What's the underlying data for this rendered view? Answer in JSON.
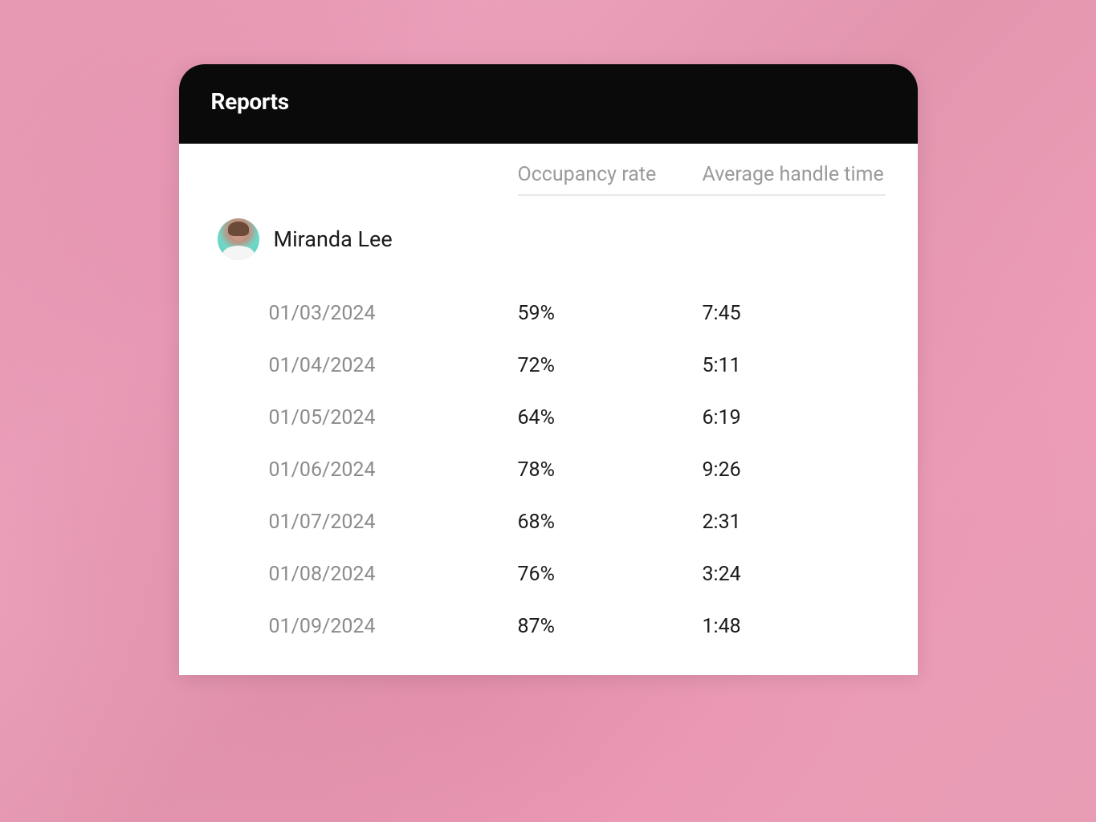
{
  "header": {
    "title": "Reports"
  },
  "columns": {
    "occupancy": "Occupancy rate",
    "handle_time": "Average handle time"
  },
  "agent": {
    "name": "Miranda Lee"
  },
  "rows": [
    {
      "date": "01/03/2024",
      "rate": "59%",
      "time": "7:45"
    },
    {
      "date": "01/04/2024",
      "rate": "72%",
      "time": "5:11"
    },
    {
      "date": "01/05/2024",
      "rate": "64%",
      "time": "6:19"
    },
    {
      "date": "01/06/2024",
      "rate": "78%",
      "time": "9:26"
    },
    {
      "date": "01/07/2024",
      "rate": "68%",
      "time": "2:31"
    },
    {
      "date": "01/08/2024",
      "rate": "76%",
      "time": "3:24"
    },
    {
      "date": "01/09/2024",
      "rate": "87%",
      "time": "1:48"
    }
  ]
}
